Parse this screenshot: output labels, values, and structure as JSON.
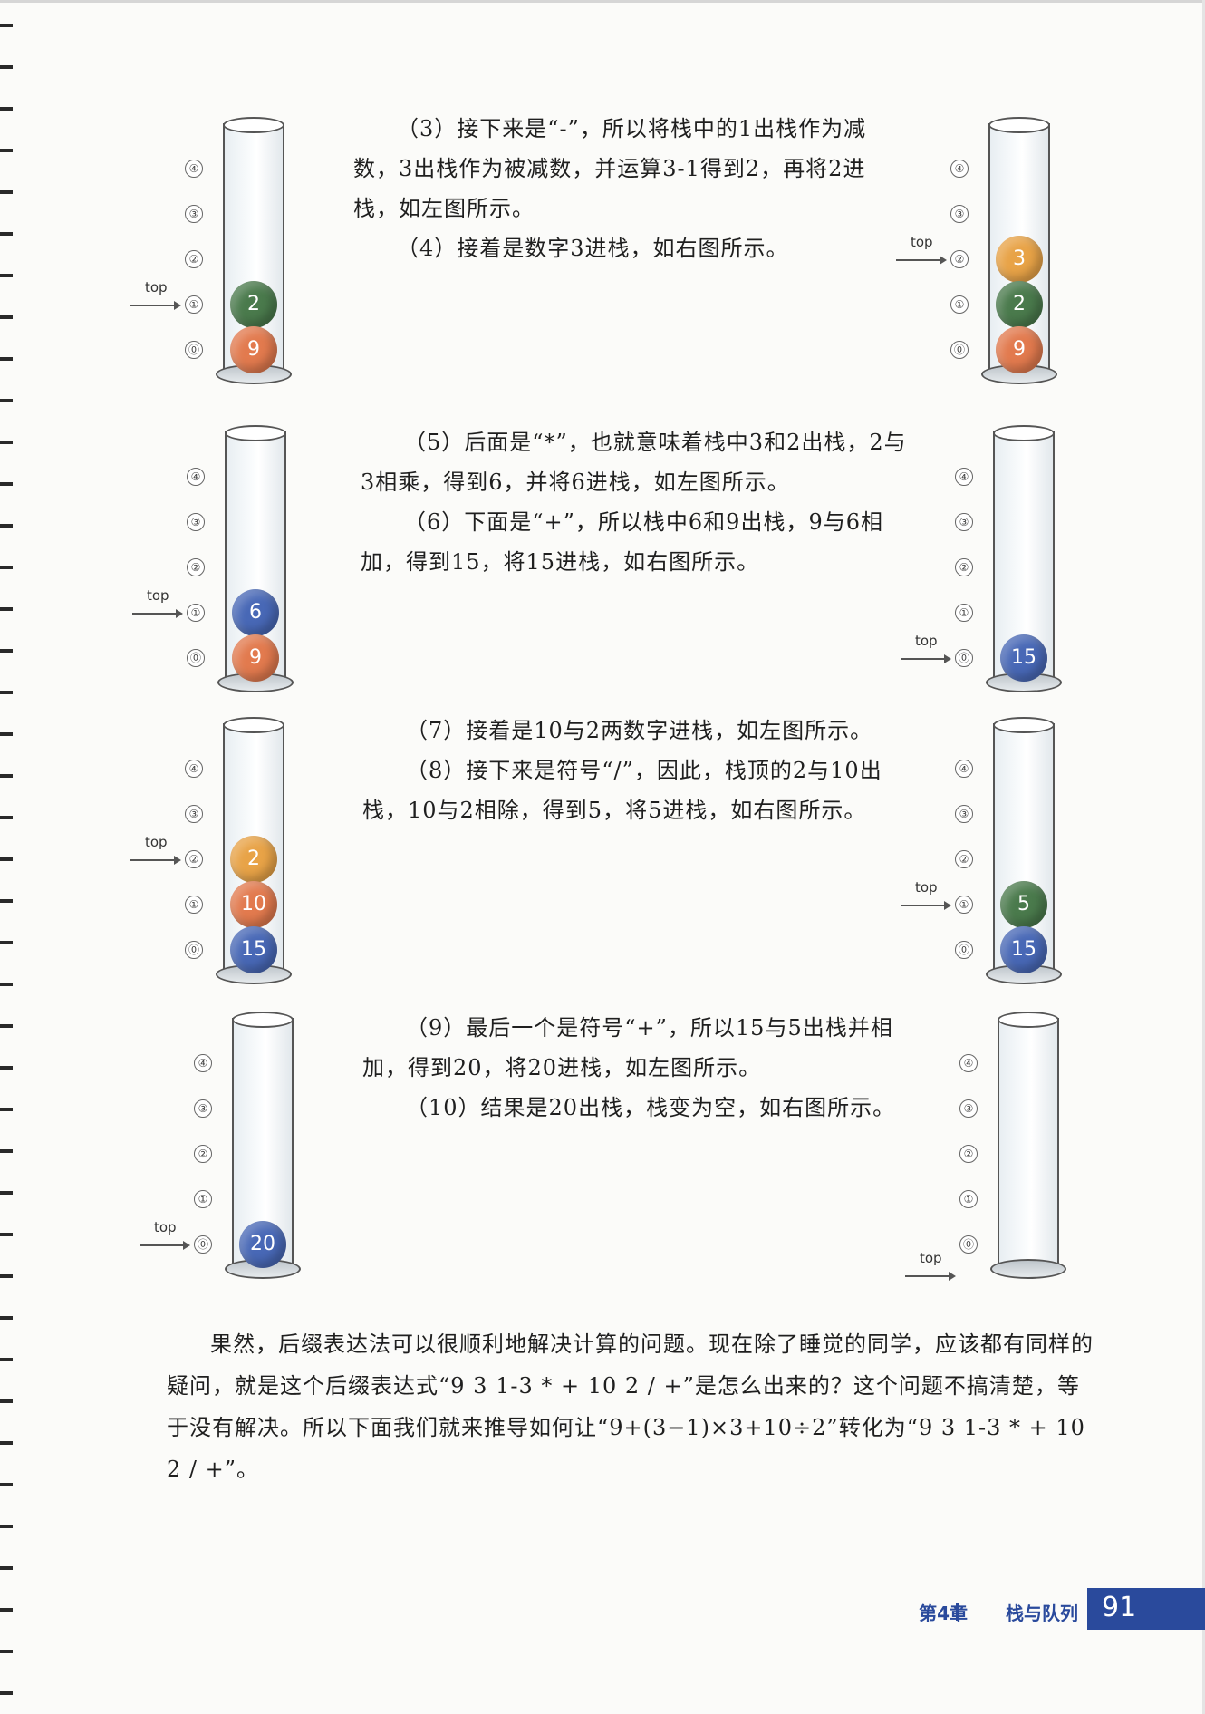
{
  "colors": {
    "orange": "#e27a4e",
    "green": "#4a7a4c",
    "blue": "#4868b6",
    "gold": "#e8a347",
    "brand": "#2a4a9c"
  },
  "slot_labels": [
    "④",
    "③",
    "②",
    "①",
    "⓪"
  ],
  "top_label": "top",
  "figures": [
    {
      "balls": [
        {
          "value": "2",
          "color": "green"
        },
        {
          "value": "9",
          "color": "orange"
        }
      ]
    },
    {
      "balls": [
        {
          "value": "3",
          "color": "gold"
        },
        {
          "value": "2",
          "color": "green"
        },
        {
          "value": "9",
          "color": "orange"
        }
      ]
    },
    {
      "balls": [
        {
          "value": "6",
          "color": "blue"
        },
        {
          "value": "9",
          "color": "orange"
        }
      ]
    },
    {
      "balls": [
        {
          "value": "15",
          "color": "blue"
        }
      ]
    },
    {
      "balls": [
        {
          "value": "2",
          "color": "gold"
        },
        {
          "value": "10",
          "color": "orange"
        },
        {
          "value": "15",
          "color": "blue"
        }
      ]
    },
    {
      "balls": [
        {
          "value": "5",
          "color": "green"
        },
        {
          "value": "15",
          "color": "blue"
        }
      ]
    },
    {
      "balls": [
        {
          "value": "20",
          "color": "blue"
        }
      ]
    },
    {
      "balls": []
    }
  ],
  "steps": {
    "s3": "（3）接下来是“-”，所以将栈中的1出栈作为减数，3出栈作为被减数，并运算3-1得到2，再将2进栈，如左图所示。",
    "s4": "（4）接着是数字3进栈，如右图所示。",
    "s5": "（5）后面是“*”，也就意味着栈中3和2出栈，2与3相乘，得到6，并将6进栈，如左图所示。",
    "s6": "（6）下面是“+”，所以栈中6和9出栈，9与6相加，得到15，将15进栈，如右图所示。",
    "s7": "（7）接着是10与2两数字进栈，如左图所示。",
    "s8": "（8）接下来是符号“/”，因此，栈顶的2与10出栈，10与2相除，得到5，将5进栈，如右图所示。",
    "s9": "（9）最后一个是符号“+”，所以15与5出栈并相加，得到20，将20进栈，如左图所示。",
    "s10": "（10）结果是20出栈，栈变为空，如右图所示。"
  },
  "conclusion": "果然，后缀表达法可以很顺利地解决计算的问题。现在除了睡觉的同学，应该都有同样的疑问，就是这个后缀表达式“9 3 1-3 * + 10 2 / +”是怎么出来的？这个问题不搞清楚，等于没有解决。所以下面我们就来推导如何让“9+(3−1)×3+10÷2”转化为“9 3 1-3 * + 10 2 / +”。",
  "footer": {
    "chapter": "第4章",
    "title": "栈与队列",
    "page_number": "91"
  }
}
